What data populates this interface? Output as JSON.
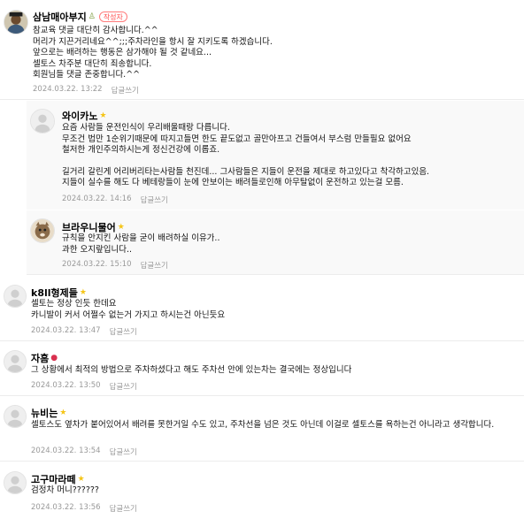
{
  "comments": [
    {
      "nickname": "삼남매아부지",
      "badge_icon": "bean-icon",
      "author_tag": "작성자",
      "lines": [
        "참교육 댓글 대단히 감사합니다.^^",
        "머리가 지끈거리네요^^;;;주차라인을 항시 잘 지키도록 하겠습니다.",
        "앞으로는 배려하는 행동은 삼가해야 될 것 같네요...",
        "셀토스 차주분 대단히 죄송합니다.",
        "회원님들 댓글 존중합니다.^^"
      ],
      "date": "2024.03.22. 13:22",
      "reply_label": "답글쓰기"
    },
    {
      "nickname": "와이카노",
      "badge_icon": "star-icon",
      "lines": [
        "요즘 사람들 운전인식이 우리배울때랑 다릅니다.",
        "무조건 법만 1순위기때문에 따지고들면 한도 끝도없고 골만아프고 건들여서 부스럼 만들필요 없어요",
        "철저한 개인주의하시는게 정신건강에 이롭죠.",
        "",
        "길거리 갈린게 어리버리타는사람들 천진데... 그사람들은 지들이 운전을 제대로 하고있다고 착각하고있음.",
        "지들이 실수를 해도 다 베테랑들이 눈에 안보이는 배려들로인해 아무탈없이 운전하고 있는걸 모름."
      ],
      "date": "2024.03.22. 14:16",
      "reply_label": "답글쓰기"
    },
    {
      "nickname": "브라우니물어",
      "badge_icon": "star-icon",
      "lines": [
        "규칙을 안지킨 사람을 굳이 배려하실 이유가..",
        "과한 오지랖입니다.."
      ],
      "date": "2024.03.22. 15:10",
      "reply_label": "답글쓰기"
    },
    {
      "nickname": "k8ll형제들",
      "badge_icon": "star-icon",
      "lines": [
        "셀토는 정상 인듯 한데요",
        "카니발이 커서 어쩔수 없는거 가지고 하시는건 아닌듯요"
      ],
      "date": "2024.03.22. 13:47",
      "reply_label": "답글쓰기"
    },
    {
      "nickname": "자흠",
      "badge_icon": "strawberry-icon",
      "lines": [
        "그 상황에서 최적의 방법으로 주차하셨다고 해도 주차선 안에 있는차는 결국에는 정상입니다"
      ],
      "date": "2024.03.22. 13:50",
      "reply_label": "답글쓰기"
    },
    {
      "nickname": "뉴비는",
      "badge_icon": "star-icon",
      "lines": [
        "셀토스도 옆차가 붙어있어서 배려를 못한거일 수도 있고, 주차선을 넘은 것도 아닌데 이걸로 셀토스를 욕하는건 아니라고 생각합니다."
      ],
      "date": "2024.03.22. 13:54",
      "reply_label": "답글쓰기"
    },
    {
      "nickname": "고구마라떼",
      "badge_icon": "star-icon",
      "lines": [
        "검정차 머니??????"
      ],
      "date": "2024.03.22. 13:56",
      "reply_label": "답글쓰기"
    }
  ]
}
